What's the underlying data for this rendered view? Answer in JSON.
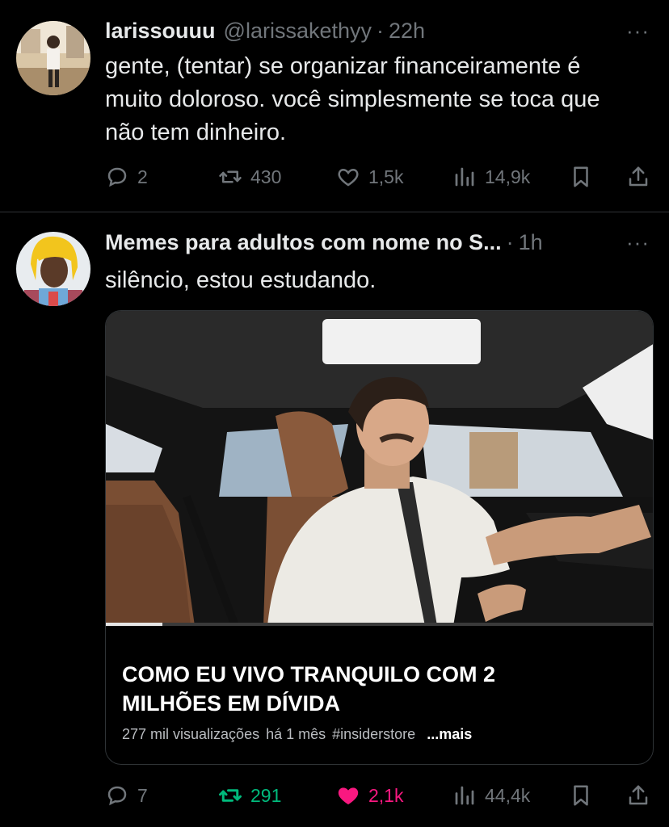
{
  "tweets": [
    {
      "display_name": "larissouuu",
      "handle": "@larissakethyy",
      "separator": "·",
      "time": "22h",
      "more": "···",
      "text": "gente, (tentar) se organizar financeiramente é\nmuito doloroso. você simplesmente se toca que\nnão tem dinheiro.",
      "replies": "2",
      "retweets": "430",
      "likes": "1,5k",
      "views": "14,9k"
    },
    {
      "display_name": "Memes para adultos com nome no S...",
      "separator": "·",
      "time": "1h",
      "more": "···",
      "text": "silêncio, estou estudando.",
      "card": {
        "title": "COMO EU VIVO TRANQUILO COM 2\nMILHÕES EM DÍVIDA",
        "views": "277 mil visualizações",
        "age": "há 1 mês",
        "hashtag": "#insiderstore",
        "more": "...mais"
      },
      "replies": "7",
      "retweets": "291",
      "likes": "2,1k",
      "views": "44,4k",
      "retweeted": true,
      "liked": true
    }
  ],
  "colors": {
    "background": "#000000",
    "text": "#e7e9ea",
    "secondary": "#71767b",
    "retweet_active": "#00ba7c",
    "like_active": "#f91880",
    "divider": "#2f3336"
  },
  "icons": [
    "reply-icon",
    "retweet-icon",
    "like-icon",
    "views-icon",
    "bookmark-icon",
    "share-icon",
    "more-icon"
  ]
}
